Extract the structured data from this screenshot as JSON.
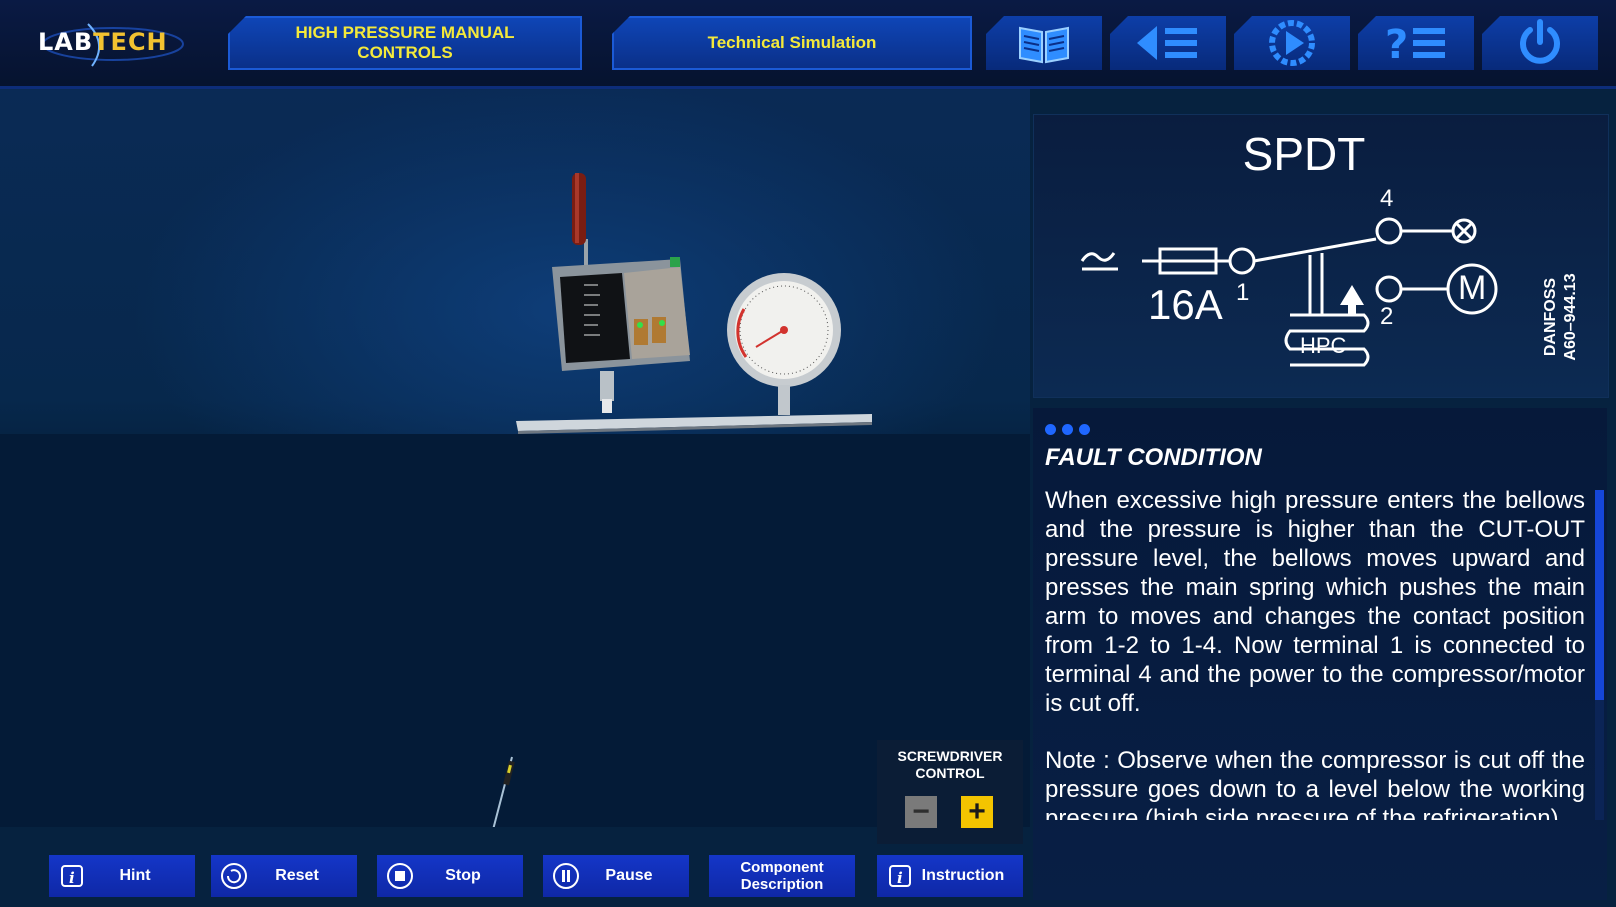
{
  "header": {
    "logo_lab": "LAB",
    "logo_tech": "TECH",
    "title": "HIGH PRESSURE MANUAL CONTROLS",
    "simulation_label": "Technical Simulation",
    "icons": [
      "book-icon",
      "menu-list-icon",
      "play-gear-icon",
      "help-list-icon",
      "power-icon"
    ]
  },
  "diagram": {
    "title": "SPDT",
    "fuse_rating": "16A",
    "terminal_1": "1",
    "terminal_2": "2",
    "terminal_4": "4",
    "motor_label": "M",
    "switch_label": "HPC",
    "brand": "DANFOSS",
    "part_number": "A60–944.13"
  },
  "fault": {
    "heading": "FAULT CONDITION",
    "paragraph_1": "When excessive high pressure enters the bellows and the pressure is higher than the CUT-OUT pressure level, the bellows moves upward and presses the main spring which pushes the main arm to moves and changes the contact position from 1-2 to 1-4. Now terminal 1 is connected to terminal 4 and the power to the compressor/motor is cut off.",
    "paragraph_2": "Note : Observe when the compressor is cut off the pressure goes down to a level below the working pressure (high side pressure of the refrigeration)"
  },
  "screwdriver": {
    "label": "SCREWDRIVER CONTROL",
    "minus": "−",
    "plus": "+"
  },
  "bottom_buttons": {
    "hint": "Hint",
    "reset": "Reset",
    "stop": "Stop",
    "pause": "Pause",
    "component_line1": "Component",
    "component_line2": "Description",
    "instruction": "Instruction"
  },
  "colors": {
    "accent_yellow": "#f4e93a",
    "button_blue": "#1436c8",
    "background": "#06223f"
  }
}
